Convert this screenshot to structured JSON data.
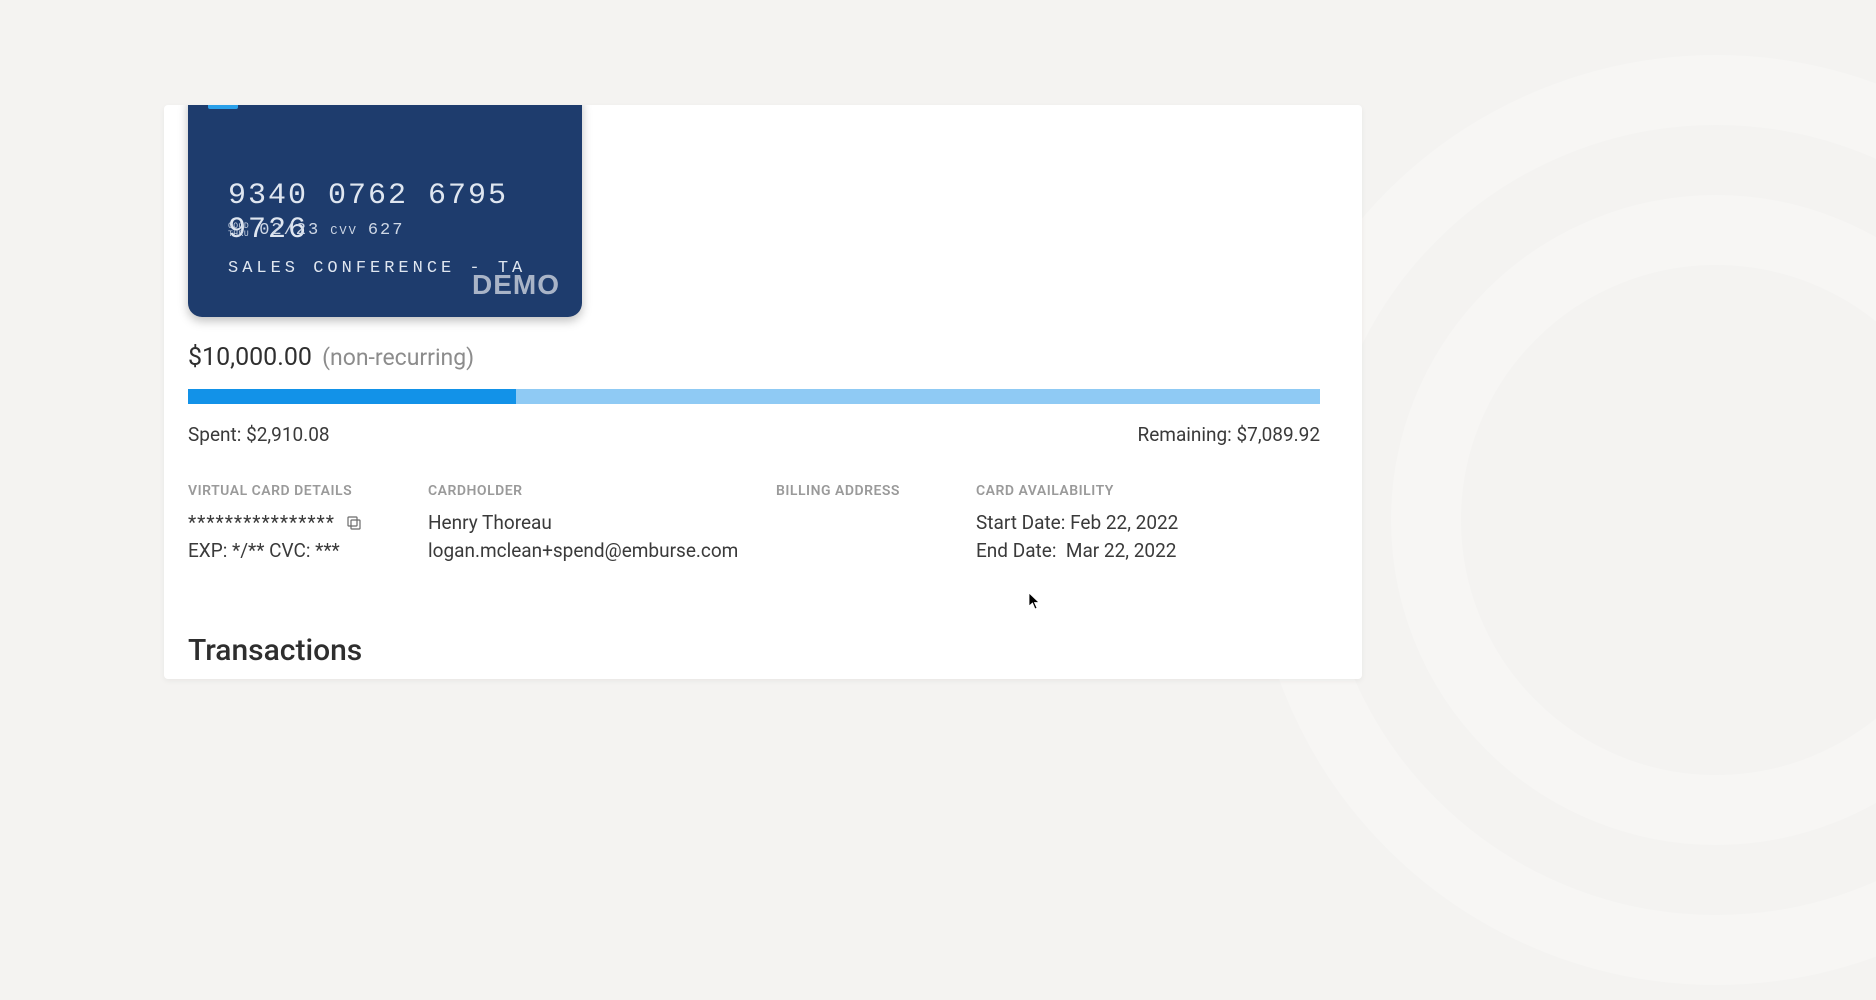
{
  "card": {
    "number": "9340 0762 6795 9726",
    "good_thru_label": "GOOD\nTHRU",
    "exp": "02/23",
    "cvv_label": "CVV",
    "cvv": "627",
    "name_on_card": "SALES CONFERENCE - TA",
    "watermark": "DEMO"
  },
  "budget": {
    "amount": "$10,000.00",
    "recurrence": "(non-recurring)",
    "spent_label": "Spent:",
    "spent_value": "$2,910.08",
    "remaining_label": "Remaining:",
    "remaining_value": "$7,089.92",
    "progress_percent": 29
  },
  "details": {
    "virtual_card": {
      "heading": "VIRTUAL CARD DETAILS",
      "masked_number": "****************",
      "exp_line": "EXP: */**   CVC: ***"
    },
    "cardholder": {
      "heading": "CARDHOLDER",
      "name": "Henry Thoreau",
      "email": "logan.mclean+spend@emburse.com"
    },
    "billing": {
      "heading": "BILLING ADDRESS"
    },
    "availability": {
      "heading": "CARD AVAILABILITY",
      "start_label": "Start Date:",
      "start_value": "Feb 22, 2022",
      "end_label": "End Date:",
      "end_value": "Mar 22, 2022"
    }
  },
  "transactions": {
    "heading": "Transactions"
  }
}
